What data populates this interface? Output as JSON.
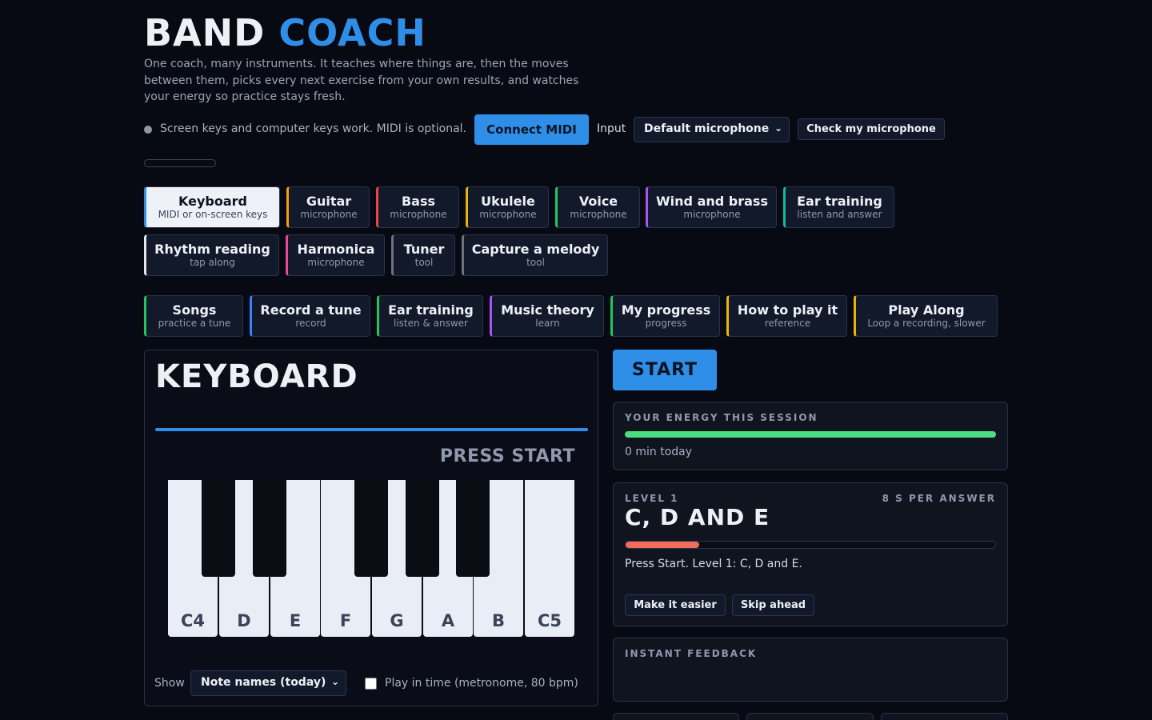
{
  "header": {
    "title_part1": "BAND",
    "title_part2": "COACH",
    "subtitle": "One coach, many instruments. It teaches where things are, then the moves between them, picks every next exercise from your own results, and watches your energy so practice stays fresh."
  },
  "status": {
    "text": "Screen keys and computer keys work. MIDI is optional.",
    "connect_midi": "Connect MIDI",
    "input_label": "Input",
    "input_selected": "Default microphone",
    "check_mic": "Check my microphone"
  },
  "instrument_tabs": [
    {
      "label": "Keyboard",
      "sub": "MIDI or on-screen keys",
      "color": "#2f8fe8",
      "active": true
    },
    {
      "label": "Guitar",
      "sub": "microphone",
      "color": "#f59e0b"
    },
    {
      "label": "Bass",
      "sub": "microphone",
      "color": "#ef4444"
    },
    {
      "label": "Ukulele",
      "sub": "microphone",
      "color": "#eab308"
    },
    {
      "label": "Voice",
      "sub": "microphone",
      "color": "#22c55e"
    },
    {
      "label": "Wind and brass",
      "sub": "microphone",
      "color": "#a855f7"
    },
    {
      "label": "Ear training",
      "sub": "listen and answer",
      "color": "#14b8a6"
    },
    {
      "label": "Rhythm reading",
      "sub": "tap along",
      "color": "#e5e7eb"
    },
    {
      "label": "Harmonica",
      "sub": "microphone",
      "color": "#ec4899"
    },
    {
      "label": "Tuner",
      "sub": "tool",
      "color": "#6b7280"
    },
    {
      "label": "Capture a melody",
      "sub": "tool",
      "color": "#6b7280"
    }
  ],
  "tool_tabs": [
    {
      "label": "Songs",
      "sub": "practice a tune",
      "color": "#22c55e"
    },
    {
      "label": "Record a tune",
      "sub": "record",
      "color": "#3b82f6"
    },
    {
      "label": "Ear training",
      "sub": "listen & answer",
      "color": "#22c55e"
    },
    {
      "label": "Music theory",
      "sub": "learn",
      "color": "#a855f7"
    },
    {
      "label": "My progress",
      "sub": "progress",
      "color": "#22c55e"
    },
    {
      "label": "How to play it",
      "sub": "reference",
      "color": "#eab308"
    },
    {
      "label": "Play Along",
      "sub": "Loop a recording, slower",
      "color": "#eab308"
    }
  ],
  "keyboard": {
    "title": "KEYBOARD",
    "prompt": "PRESS START",
    "white_keys": [
      "C4",
      "D",
      "E",
      "F",
      "G",
      "A",
      "B",
      "C5"
    ],
    "show_label": "Show",
    "show_selected": "Note names (today)",
    "metronome_label": "Play in time (metronome, 80 bpm)",
    "metronome_checked": false
  },
  "session": {
    "start": "START",
    "energy_caption": "YOUR ENERGY THIS SESSION",
    "energy_level": 1.0,
    "energy_text": "0 min today"
  },
  "level": {
    "caption": "LEVEL 1",
    "per_answer": "8 S PER ANSWER",
    "name": "C, D AND E",
    "progress": 0.2,
    "message": "Press Start. Level 1: C, D and E.",
    "easier": "Make it easier",
    "skip": "Skip ahead"
  },
  "feedback": {
    "caption": "INSTANT FEEDBACK"
  }
}
